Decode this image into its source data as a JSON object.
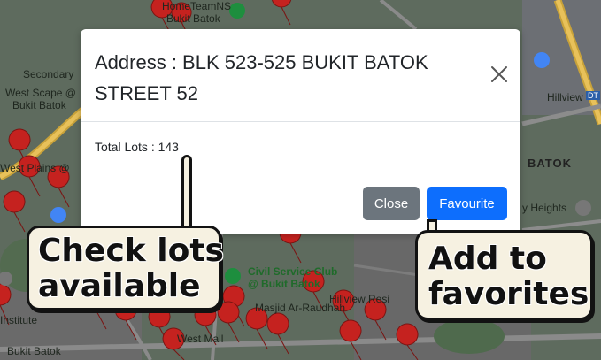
{
  "map": {
    "labels": {
      "hometeam": "HomeTeamNS",
      "bukit_batok_top": "Bukit Batok",
      "secondary": "Secondary",
      "west_scape": "West Scape @",
      "bukit_batok_left": "Bukit Batok",
      "west_plains": "West Plains @",
      "hillview": "Hillview",
      "batok": "BATOK",
      "heights": "y Heights",
      "civil_service": "Civil Service Club",
      "civil_service_2": "@ Bukit Batok",
      "hillview_res": "Hillview Resi",
      "masjid": "Masjid Ar-Raudhah",
      "institute": "Institute",
      "west_mall": "West Mall",
      "bukit_batok_bottom": "Bukit Batok",
      "transit": "DT"
    },
    "colors": {
      "pin": "#c5221f",
      "map_bg": "#5d6a5d",
      "road": "#c8a23a"
    }
  },
  "modal": {
    "title": "Address : BLK 523-525 BUKIT BATOK STREET 52",
    "total_lots": "Total Lots : 143",
    "close_label": "Close",
    "favourite_label": "Favourite"
  },
  "annotations": {
    "check_line1": "Check lots",
    "check_line2": "available",
    "fav_line1": "Add to",
    "fav_line2": "favorites"
  }
}
